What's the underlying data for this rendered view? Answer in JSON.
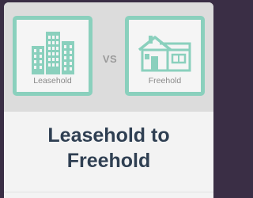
{
  "left_tile": {
    "caption": "Leasehold",
    "icon": "apartment-building-icon"
  },
  "vs_label": "VS",
  "right_tile": {
    "caption": "Freehold",
    "icon": "house-icon"
  },
  "title": {
    "line1": "Leasehold to",
    "line2": "Freehold"
  },
  "colors": {
    "tile_border": "#8ad0bd",
    "icon_fill": "#8ad0bd",
    "title_text": "#2f3f52",
    "banner_bg": "#dcdcdc",
    "page_bg": "#3a2e45"
  }
}
